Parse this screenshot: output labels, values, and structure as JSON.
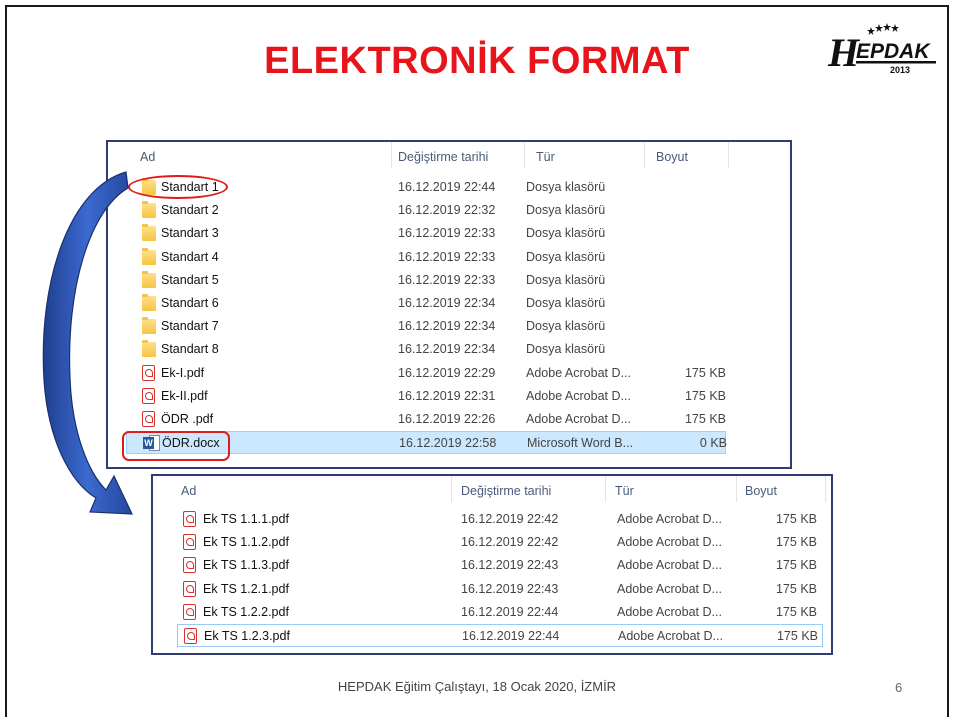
{
  "slide": {
    "title": "ELEKTRONİK FORMAT",
    "footer": "HEPDAK Eğitim Çalıştayı, 18 Ocak 2020, İZMİR",
    "page_number": "6",
    "title_color": "#e8141c",
    "highlight_color": "#e01b1b"
  },
  "logo": {
    "text": "EPDAK",
    "letter": "H",
    "year": "2013"
  },
  "pane1": {
    "columns": [
      "Ad",
      "Değiştirme tarihi",
      "Tür",
      "Boyut"
    ],
    "rows": [
      {
        "icon": "folder-icon",
        "name": "Standart 1",
        "date": "16.12.2019 22:44",
        "type": "Dosya klasörü",
        "size": ""
      },
      {
        "icon": "folder-icon",
        "name": "Standart 2",
        "date": "16.12.2019 22:32",
        "type": "Dosya klasörü",
        "size": ""
      },
      {
        "icon": "folder-icon",
        "name": "Standart 3",
        "date": "16.12.2019 22:33",
        "type": "Dosya klasörü",
        "size": ""
      },
      {
        "icon": "folder-icon",
        "name": "Standart 4",
        "date": "16.12.2019 22:33",
        "type": "Dosya klasörü",
        "size": ""
      },
      {
        "icon": "folder-icon",
        "name": "Standart 5",
        "date": "16.12.2019 22:33",
        "type": "Dosya klasörü",
        "size": ""
      },
      {
        "icon": "folder-icon",
        "name": "Standart 6",
        "date": "16.12.2019 22:34",
        "type": "Dosya klasörü",
        "size": ""
      },
      {
        "icon": "folder-icon",
        "name": "Standart 7",
        "date": "16.12.2019 22:34",
        "type": "Dosya klasörü",
        "size": ""
      },
      {
        "icon": "folder-icon",
        "name": "Standart 8",
        "date": "16.12.2019 22:34",
        "type": "Dosya klasörü",
        "size": ""
      },
      {
        "icon": "pdf-icon",
        "name": "Ek-I.pdf",
        "date": "16.12.2019 22:29",
        "type": "Adobe Acrobat D...",
        "size": "175 KB"
      },
      {
        "icon": "pdf-icon",
        "name": "Ek-II.pdf",
        "date": "16.12.2019 22:31",
        "type": "Adobe Acrobat D...",
        "size": "175 KB"
      },
      {
        "icon": "pdf-icon",
        "name": "ÖDR .pdf",
        "date": "16.12.2019 22:26",
        "type": "Adobe Acrobat D...",
        "size": "175 KB"
      },
      {
        "icon": "word-icon",
        "name": "ÖDR.docx",
        "date": "16.12.2019 22:58",
        "type": "Microsoft Word B...",
        "size": "0 KB"
      }
    ]
  },
  "pane2": {
    "columns": [
      "Ad",
      "Değiştirme tarihi",
      "Tür",
      "Boyut"
    ],
    "rows": [
      {
        "icon": "pdf-icon",
        "name": "Ek TS 1.1.1.pdf",
        "date": "16.12.2019 22:42",
        "type": "Adobe Acrobat D...",
        "size": "175 KB"
      },
      {
        "icon": "pdf-icon",
        "name": "Ek TS 1.1.2.pdf",
        "date": "16.12.2019 22:42",
        "type": "Adobe Acrobat D...",
        "size": "175 KB"
      },
      {
        "icon": "pdf-icon",
        "name": "Ek TS 1.1.3.pdf",
        "date": "16.12.2019 22:43",
        "type": "Adobe Acrobat D...",
        "size": "175 KB"
      },
      {
        "icon": "pdf-icon",
        "name": "Ek TS 1.2.1.pdf",
        "date": "16.12.2019 22:43",
        "type": "Adobe Acrobat D...",
        "size": "175 KB"
      },
      {
        "icon": "pdf-icon",
        "name": "Ek TS 1.2.2.pdf",
        "date": "16.12.2019 22:44",
        "type": "Adobe Acrobat D...",
        "size": "175 KB"
      },
      {
        "icon": "pdf-icon",
        "name": "Ek TS 1.2.3.pdf",
        "date": "16.12.2019 22:44",
        "type": "Adobe Acrobat D...",
        "size": "175 KB"
      }
    ]
  }
}
